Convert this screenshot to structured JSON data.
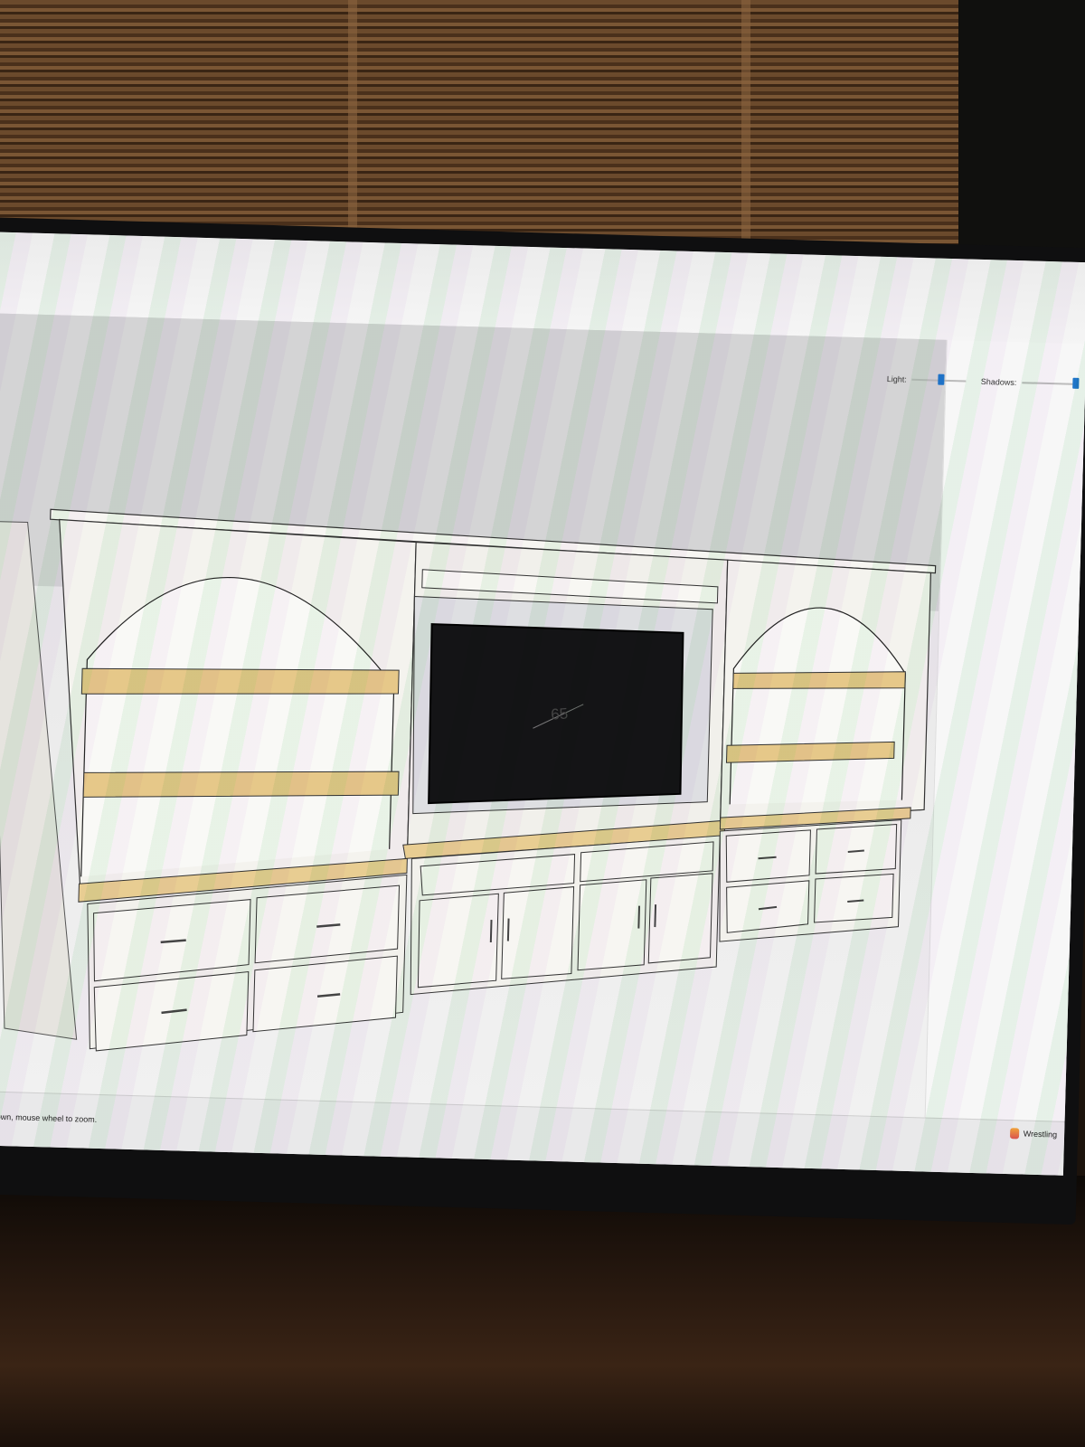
{
  "style_panel": {
    "light_label": "Light:",
    "shadows_label": "Shadows:",
    "light_level": 0.5,
    "shadows_level": 0.95
  },
  "model": {
    "tv_dimension_label": "65"
  },
  "status_bar": {
    "hint": "nd down, mouse wheel to zoom."
  },
  "taskbar": {
    "app_label": "Wrestling"
  },
  "colors": {
    "accent": "#1f76c9",
    "cabinet": "#f4f3ee",
    "wood_top": "#e6c889",
    "tv": "#141416"
  },
  "icons": [
    "slider-thumb-icon",
    "app-icon"
  ]
}
